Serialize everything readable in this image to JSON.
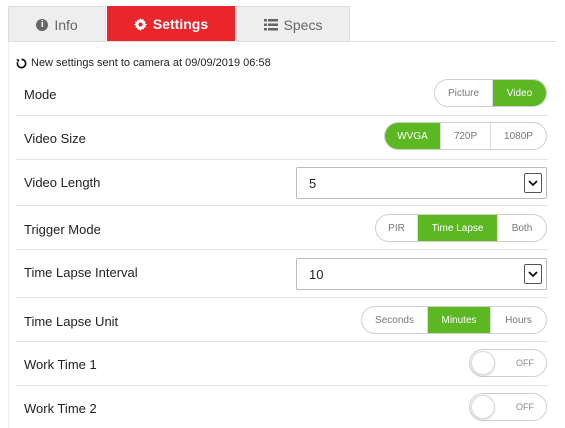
{
  "tabs": [
    {
      "label": "Info",
      "icon": "info-icon"
    },
    {
      "label": "Settings",
      "icon": "gear-icon",
      "active": true
    },
    {
      "label": "Specs",
      "icon": "list-icon"
    }
  ],
  "status": {
    "text": "New settings sent to camera at 09/09/2019 06:58",
    "icon": "refresh-icon"
  },
  "mode": {
    "label": "Mode",
    "options": [
      "Picture",
      "Video"
    ],
    "selected": "Video"
  },
  "video_size": {
    "label": "Video Size",
    "options": [
      "WVGA",
      "720P",
      "1080P"
    ],
    "selected": "WVGA"
  },
  "video_length": {
    "label": "Video Length",
    "value": "5"
  },
  "trigger_mode": {
    "label": "Trigger Mode",
    "options": [
      "PIR",
      "Time Lapse",
      "Both"
    ],
    "selected": "Time Lapse"
  },
  "time_lapse_interval": {
    "label": "Time Lapse Interval",
    "value": "10"
  },
  "time_lapse_unit": {
    "label": "Time Lapse Unit",
    "options": [
      "Seconds",
      "Minutes",
      "Hours"
    ],
    "selected": "Minutes"
  },
  "work_time_1": {
    "label": "Work Time 1",
    "state": "OFF"
  },
  "work_time_2": {
    "label": "Work Time 2",
    "state": "OFF"
  },
  "colors": {
    "accent_red": "#e8262b",
    "accent_green": "#5cb822"
  }
}
